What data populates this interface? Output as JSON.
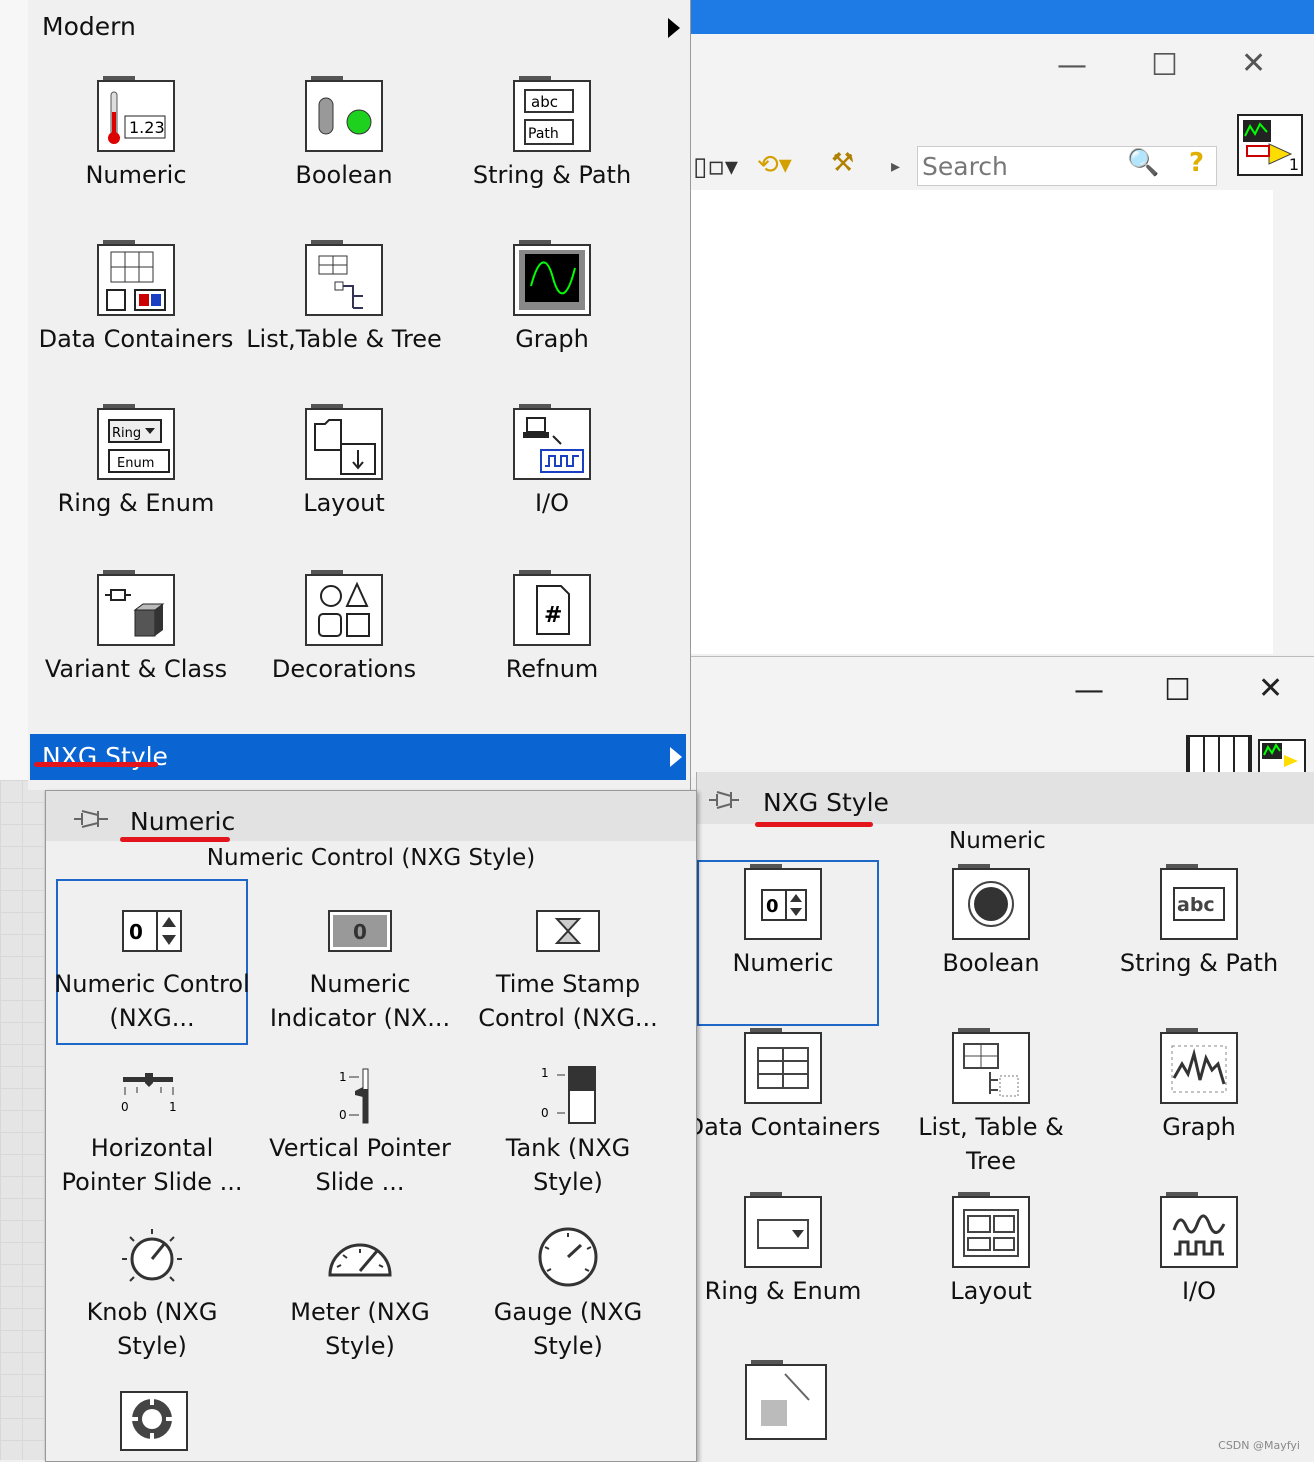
{
  "modern_palette": {
    "title": "Modern",
    "items": [
      {
        "label": "Numeric",
        "icon": "numeric-icon"
      },
      {
        "label": "Boolean",
        "icon": "boolean-icon"
      },
      {
        "label": "String & Path",
        "icon": "string-path-icon"
      },
      {
        "label": "Data Containers",
        "icon": "data-containers-icon"
      },
      {
        "label": "List,Table & Tree",
        "icon": "list-table-tree-icon"
      },
      {
        "label": "Graph",
        "icon": "graph-icon"
      },
      {
        "label": "Ring & Enum",
        "icon": "ring-enum-icon"
      },
      {
        "label": "Layout",
        "icon": "layout-icon"
      },
      {
        "label": "I/O",
        "icon": "io-icon"
      },
      {
        "label": "Variant & Class",
        "icon": "variant-class-icon"
      },
      {
        "label": "Decorations",
        "icon": "decorations-icon"
      },
      {
        "label": "Refnum",
        "icon": "refnum-icon"
      }
    ],
    "selected_submenu": "NXG Style",
    "icon_text": {
      "numeric_value": "1.23",
      "abc": "abc",
      "path": "Path",
      "ring": "Ring",
      "enum": "Enum",
      "hash": "#"
    }
  },
  "toolbar": {
    "search_placeholder": "Search",
    "badge": "1"
  },
  "numeric_subpalette": {
    "title": "Numeric",
    "hovered_item": "Numeric Control (NXG Style)",
    "items": [
      {
        "label": "Numeric Control (NXG...",
        "icon": "numeric-control-icon"
      },
      {
        "label": "Numeric Indicator (NX...",
        "icon": "numeric-indicator-icon"
      },
      {
        "label": "Time Stamp Control (NXG...",
        "icon": "time-stamp-icon"
      },
      {
        "label": "Horizontal Pointer Slide ...",
        "icon": "horizontal-slide-icon"
      },
      {
        "label": "Vertical Pointer Slide ...",
        "icon": "vertical-slide-icon"
      },
      {
        "label": "Tank (NXG Style)",
        "icon": "tank-icon"
      },
      {
        "label": "Knob (NXG Style)",
        "icon": "knob-icon"
      },
      {
        "label": "Meter (NXG Style)",
        "icon": "meter-icon"
      },
      {
        "label": "Gauge (NXG Style)",
        "icon": "gauge-icon"
      }
    ],
    "icon_text": {
      "zero": "0",
      "one": "1"
    }
  },
  "nxg_palette": {
    "title": "NXG Style",
    "hovered_item": "Numeric",
    "items": [
      {
        "label": "Numeric",
        "icon": "nxg-numeric-icon"
      },
      {
        "label": "Boolean",
        "icon": "nxg-boolean-icon"
      },
      {
        "label": "String & Path",
        "icon": "nxg-string-icon"
      },
      {
        "label": "Data Containers",
        "icon": "nxg-data-containers-icon"
      },
      {
        "label": "List, Table & Tree",
        "icon": "nxg-list-icon"
      },
      {
        "label": "Graph",
        "icon": "nxg-graph-icon"
      },
      {
        "label": "Ring & Enum",
        "icon": "nxg-ring-icon"
      },
      {
        "label": "Layout",
        "icon": "nxg-layout-icon"
      },
      {
        "label": "I/O",
        "icon": "nxg-io-icon"
      }
    ],
    "icon_text": {
      "zero": "0",
      "abc": "abc"
    }
  },
  "watermark": "CSDN @Mayfyi",
  "colors": {
    "highlight": "#0a64d2",
    "underline": "#e3141b",
    "selection_border": "#1d67c8"
  }
}
